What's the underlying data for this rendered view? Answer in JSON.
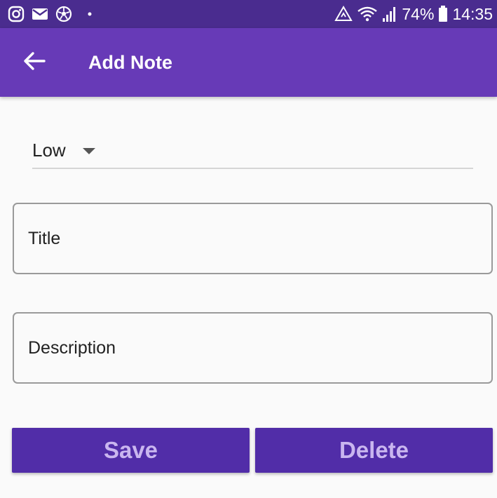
{
  "status_bar": {
    "left_icons": [
      "instagram-icon",
      "mail-icon",
      "soccer-ball-icon",
      "dot-icon"
    ],
    "right_icons": [
      "data-saver-icon",
      "wifi-icon",
      "signal-icon",
      "battery-icon"
    ],
    "battery": "74%",
    "time": "14:35"
  },
  "app_bar": {
    "title": "Add Note",
    "back_icon": "arrow-back-icon"
  },
  "priority": {
    "selected": "Low",
    "caret_icon": "dropdown-caret-icon"
  },
  "form": {
    "title_placeholder": "Title",
    "description_placeholder": "Description"
  },
  "buttons": {
    "save": "Save",
    "delete": "Delete"
  },
  "colors": {
    "status_bar": "#4a2c8f",
    "app_bar": "#673ab7",
    "button_bg": "#512da8",
    "button_text": "#c9b6ef",
    "background": "#fafafa"
  }
}
